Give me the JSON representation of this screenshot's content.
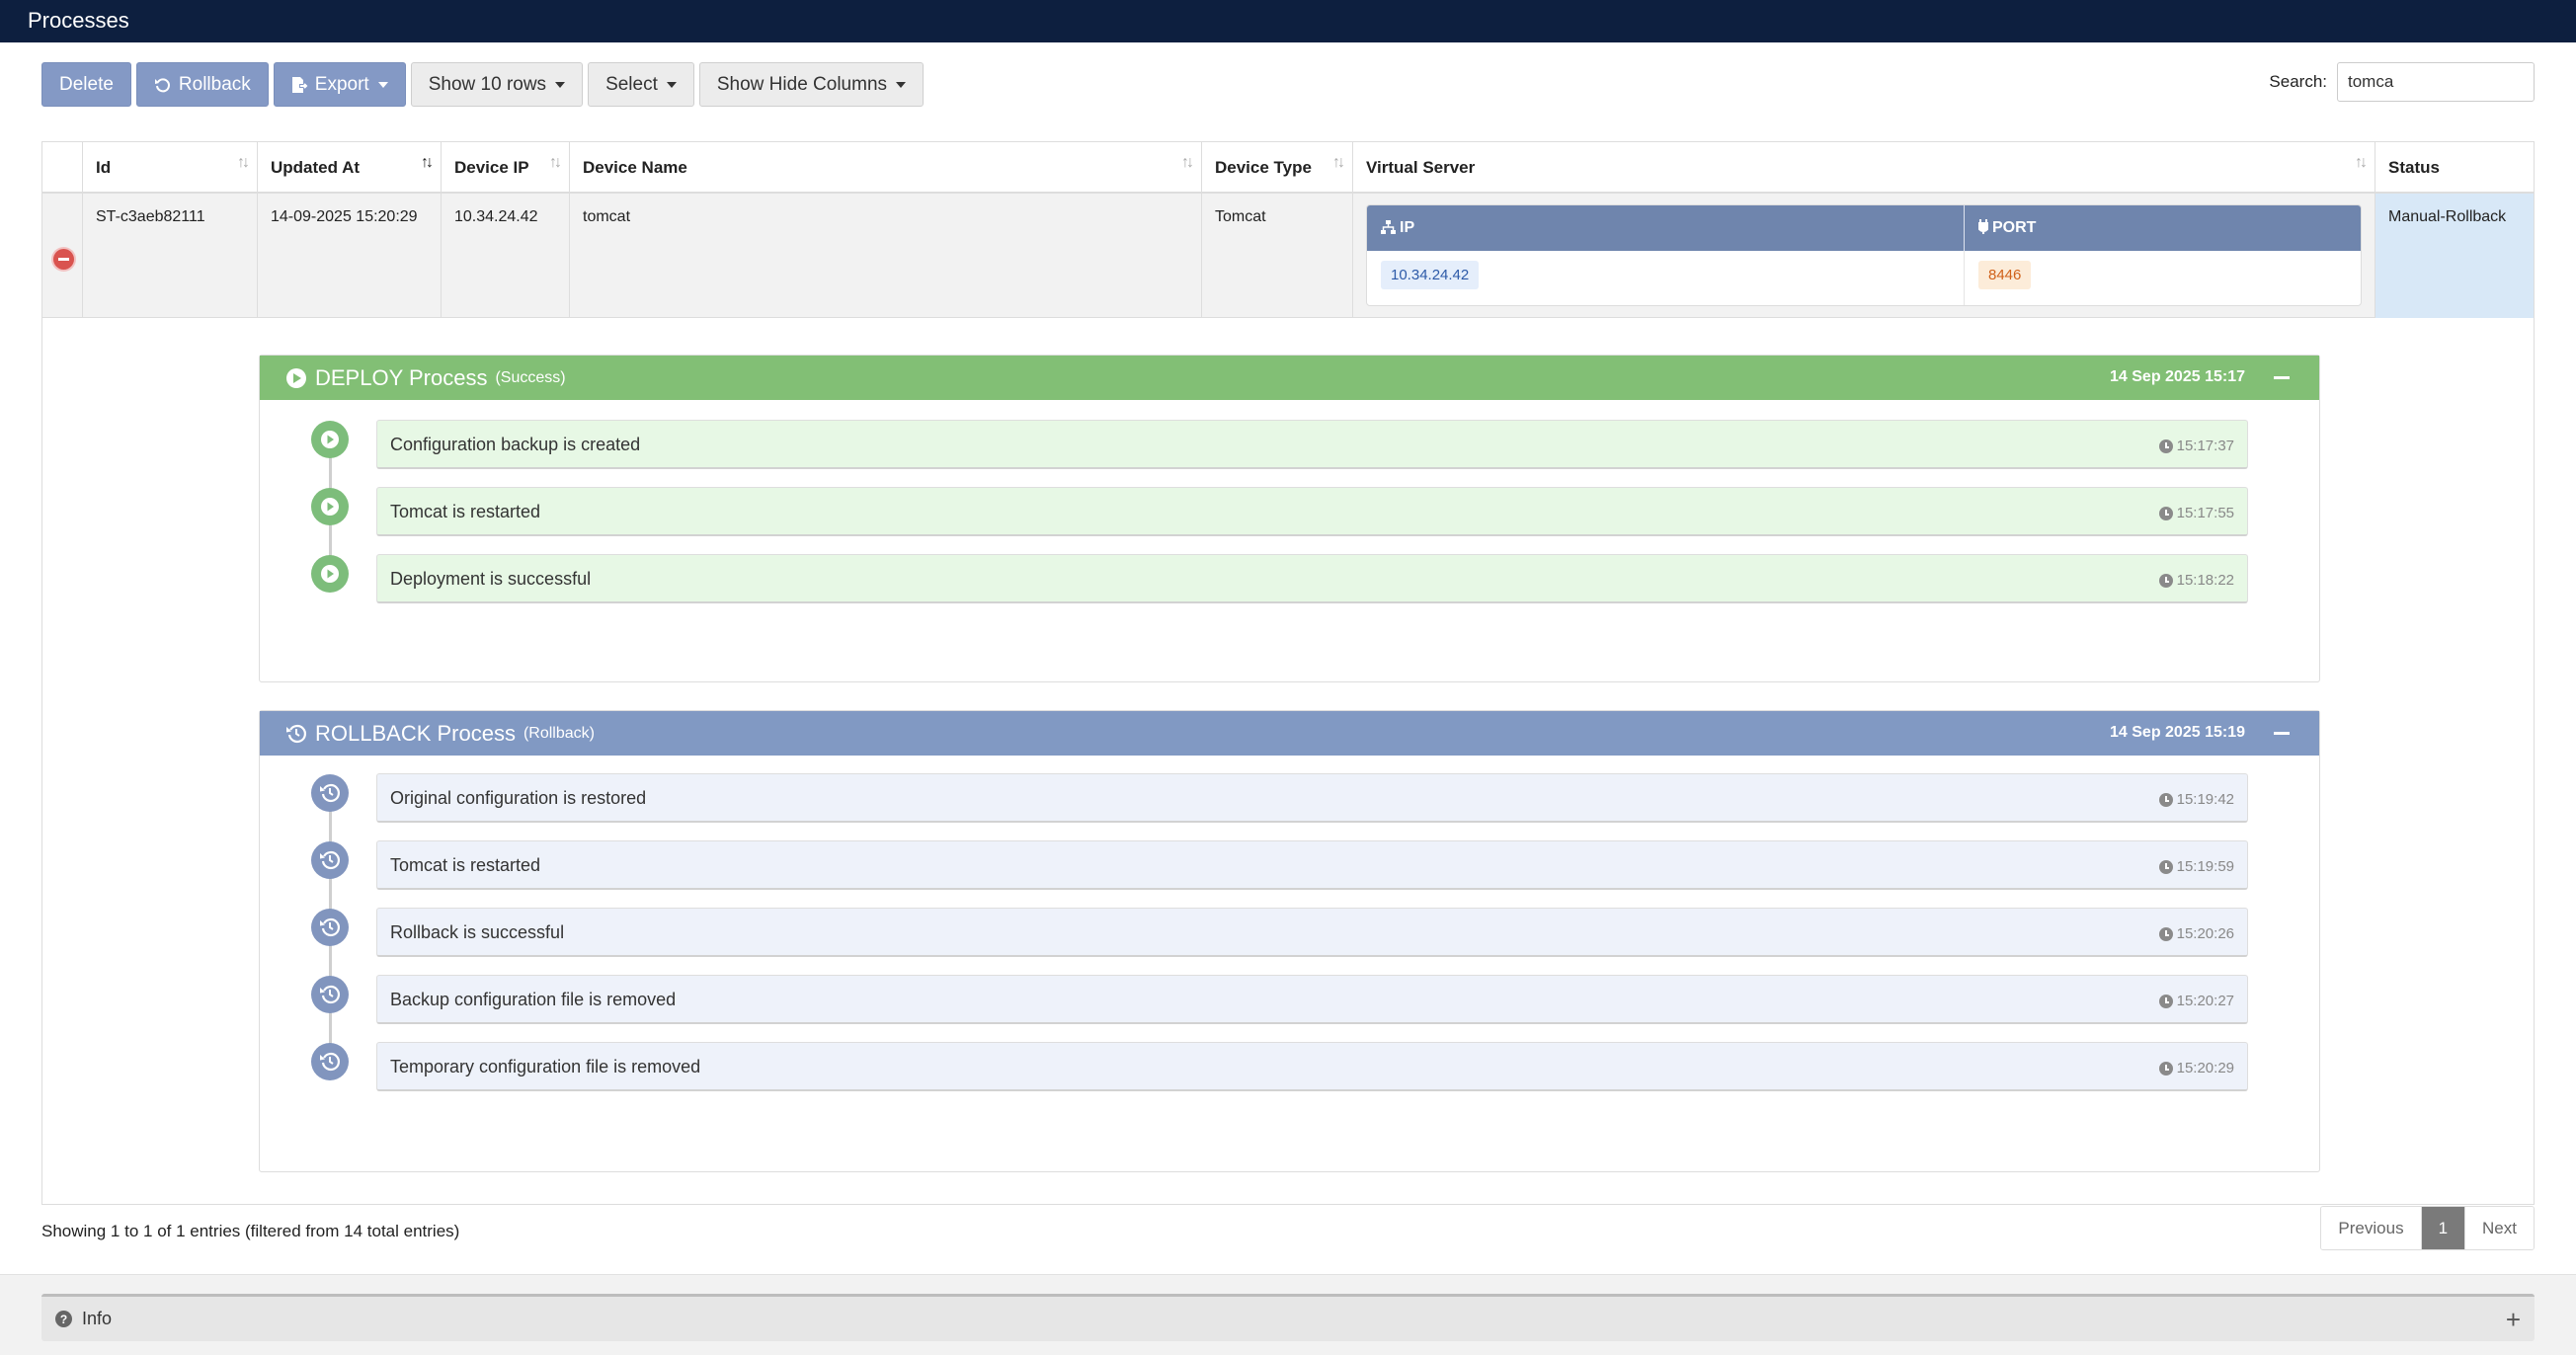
{
  "app": {
    "title": "Processes"
  },
  "toolbar": {
    "delete_label": "Delete",
    "rollback_label": "Rollback",
    "export_label": "Export",
    "show_rows_label": "Show 10 rows",
    "select_label": "Select",
    "show_hide_columns_label": "Show Hide Columns"
  },
  "search": {
    "label": "Search:",
    "value": "tomca"
  },
  "table": {
    "columns": [
      "Id",
      "Updated At",
      "Device IP",
      "Device Name",
      "Device Type",
      "Virtual Server",
      "Status"
    ],
    "rows": [
      {
        "id": "ST-c3aeb82111",
        "updated_at": "14-09-2025 15:20:29",
        "device_ip": "10.34.24.42",
        "device_name": "tomcat",
        "device_type": "Tomcat",
        "virtual_server": {
          "ip_header": "IP",
          "port_header": "PORT",
          "ip": "10.34.24.42",
          "port": "8446"
        },
        "status": "Manual-Rollback"
      }
    ]
  },
  "processes": [
    {
      "title": "DEPLOY Process",
      "subtitle": "(Success)",
      "date": "14 Sep 2025 15:17",
      "color": "#82bf75",
      "steps": [
        {
          "text": "Configuration backup is created",
          "time": "15:17:37"
        },
        {
          "text": "Tomcat is restarted",
          "time": "15:17:55"
        },
        {
          "text": "Deployment is successful",
          "time": "15:18:22"
        }
      ]
    },
    {
      "title": "ROLLBACK Process",
      "subtitle": "(Rollback)",
      "date": "14 Sep 2025 15:19",
      "color": "#8199c3",
      "steps": [
        {
          "text": "Original configuration is restored",
          "time": "15:19:42"
        },
        {
          "text": "Tomcat is restarted",
          "time": "15:19:59"
        },
        {
          "text": "Rollback is successful",
          "time": "15:20:26"
        },
        {
          "text": "Backup configuration file is removed",
          "time": "15:20:27"
        },
        {
          "text": "Temporary configuration file is removed",
          "time": "15:20:29"
        }
      ]
    }
  ],
  "footer": {
    "showing_text": "Showing 1 to 1 of 1 entries (filtered from 14 total entries)",
    "pagination": {
      "previous": "Previous",
      "current": "1",
      "next": "Next"
    }
  },
  "info_panel": {
    "label": "Info"
  }
}
